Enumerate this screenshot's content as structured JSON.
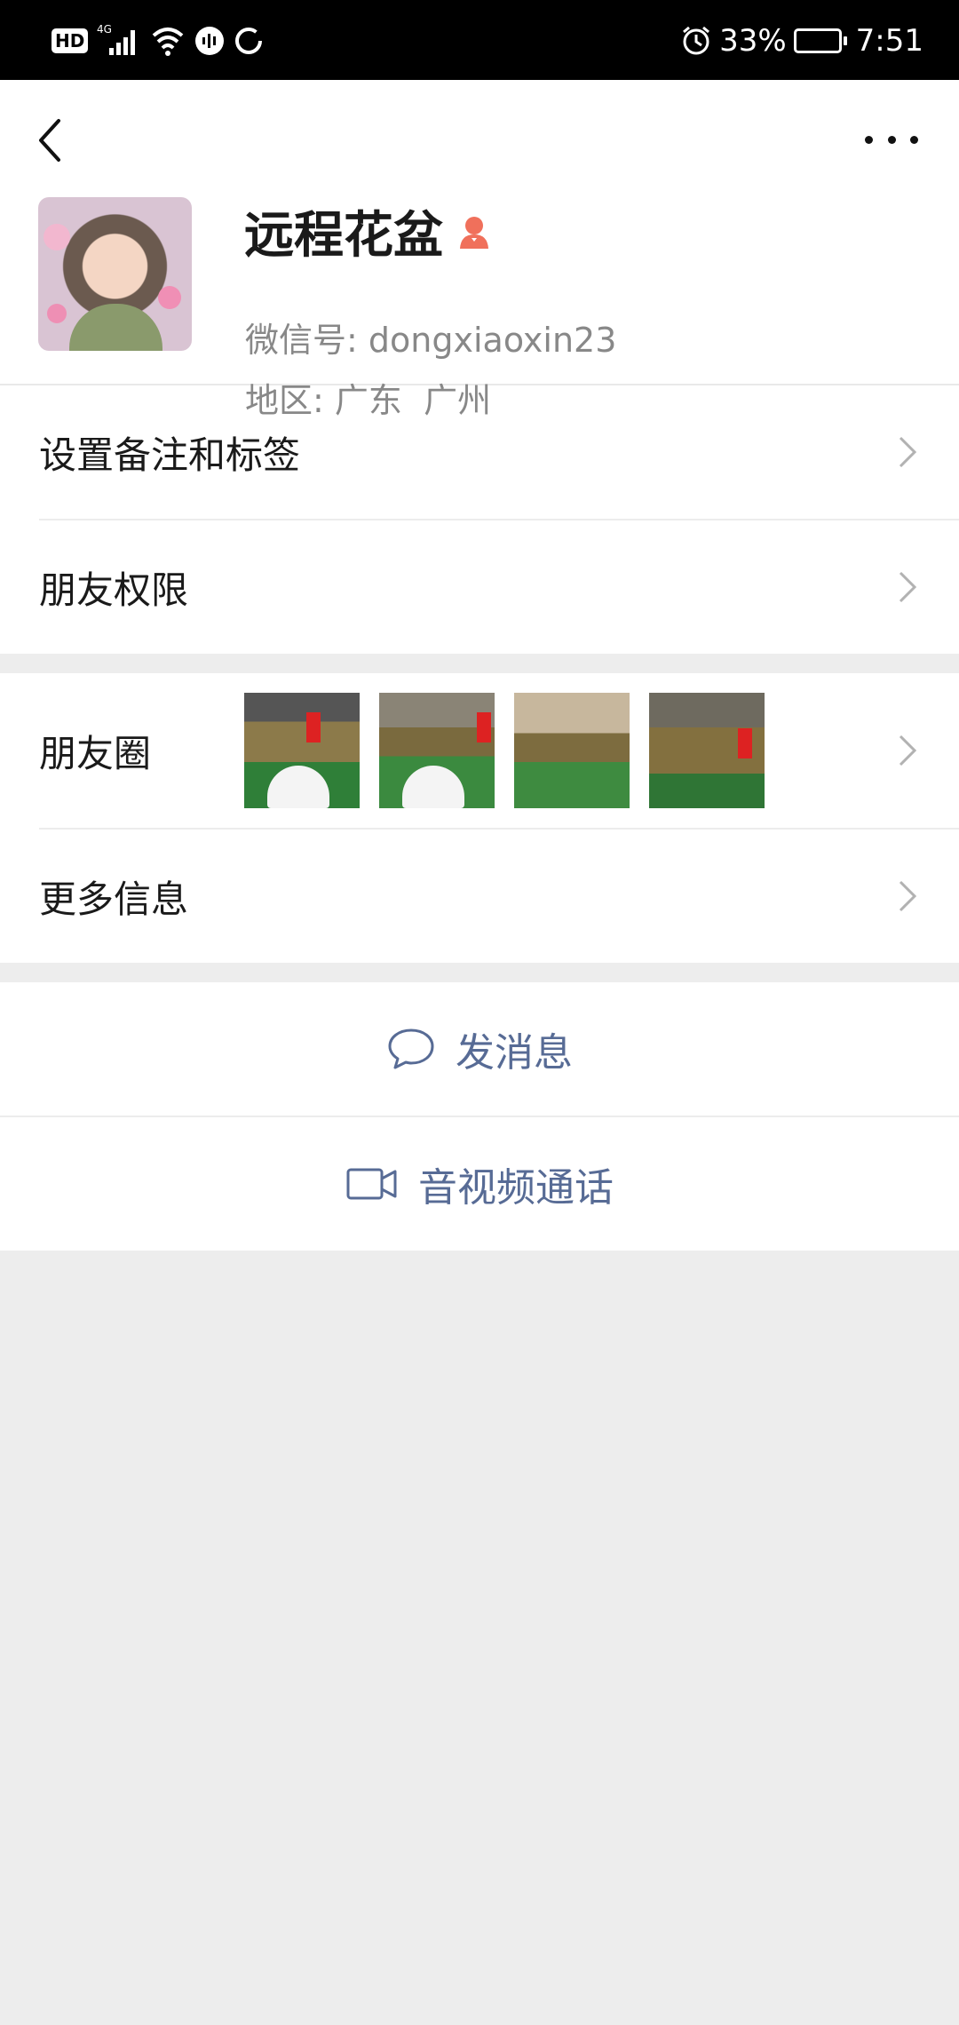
{
  "status_bar": {
    "hd": "HD",
    "network": "4G",
    "battery": "33%",
    "time": "7:51"
  },
  "profile": {
    "name": "远程花盆",
    "wechat_id_label": "微信号:",
    "wechat_id": "dongxiaoxin23",
    "region_label": "地区:",
    "region": "广东  广州"
  },
  "rows": {
    "remarks": "设置备注和标签",
    "permissions": "朋友权限",
    "moments": "朋友圈",
    "more_info": "更多信息"
  },
  "actions": {
    "message": "发消息",
    "video_call": "音视频通话"
  },
  "colors": {
    "link": "#576b95",
    "female_icon": "#f0705b"
  }
}
